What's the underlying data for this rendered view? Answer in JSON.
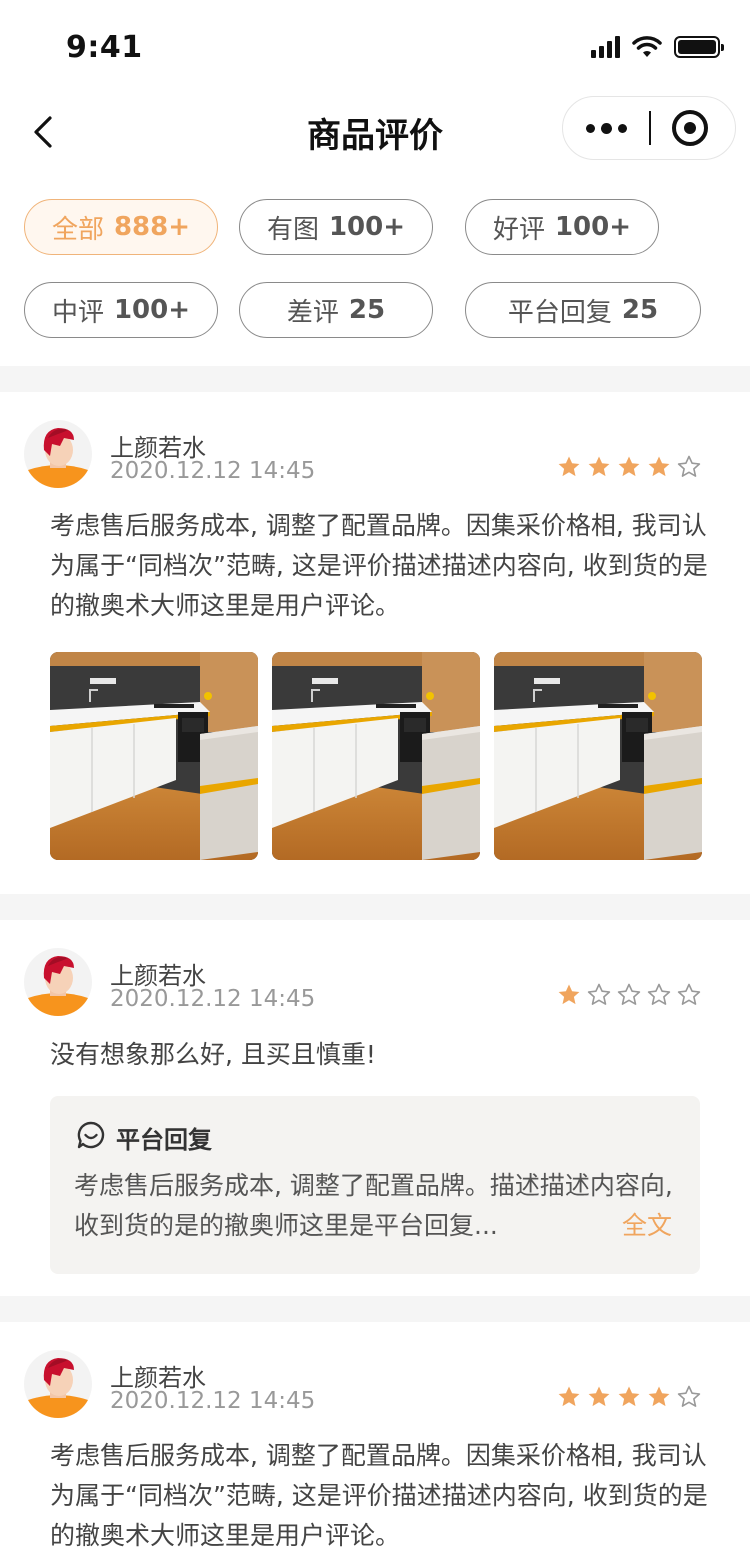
{
  "status_bar": {
    "time": "9:41"
  },
  "nav": {
    "title": "商品评价"
  },
  "filters": [
    {
      "label": "全部",
      "count": "888+",
      "active": true
    },
    {
      "label": "有图",
      "count": "100+",
      "active": false
    },
    {
      "label": "好评",
      "count": "100+",
      "active": false
    },
    {
      "label": "中评",
      "count": "100+",
      "active": false
    },
    {
      "label": "差评",
      "count": "25",
      "active": false
    },
    {
      "label": "平台回复",
      "count": "25",
      "active": false
    }
  ],
  "reviews": [
    {
      "user": "上颜若水",
      "date": "2020.12.12 14:45",
      "rating": 4,
      "max_rating": 5,
      "text": "考虑售后服务成本, 调整了配置品牌。因集采价格相, 我司认为属于“同档次”范畴, 这是评价描述描述内容向, 收到货的是的撤奥术大师这里是用户评论。"
    },
    {
      "user": "上颜若水",
      "date": "2020.12.12 14:45",
      "rating": 1,
      "max_rating": 5,
      "text": "没有想象那么好, 且买且慎重!",
      "reply": {
        "title": "平台回复",
        "text": "考虑售后服务成本, 调整了配置品牌。描述描述内容向, 收到货的是的撤奥师这里是平台回复...",
        "more_label": "全文"
      }
    },
    {
      "user": "上颜若水",
      "date": "2020.12.12 14:45",
      "rating": 4,
      "max_rating": 5,
      "text": "考虑售后服务成本, 调整了配置品牌。因集采价格相, 我司认为属于“同档次”范畴, 这是评价描述描述内容向, 收到货的是的撤奥术大师这里是用户评论。"
    }
  ],
  "colors": {
    "accent": "#f0a55e",
    "star_filled": "#f0a55e",
    "star_empty": "#999999"
  },
  "icons": {
    "back": "chevron-left-icon",
    "more": "more-dots-icon",
    "close": "target-close-icon",
    "reply": "chat-bubble-icon"
  }
}
